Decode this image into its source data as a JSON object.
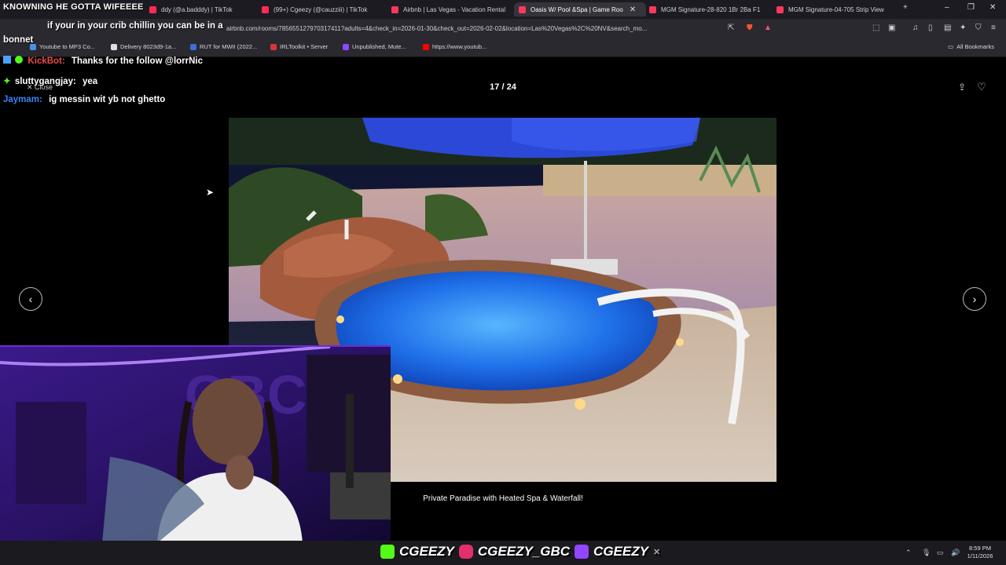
{
  "tabs": [
    {
      "label": "ddy (@a.badddy) | TikTok",
      "color": "#fe2c55"
    },
    {
      "label": "(99+) Cgeezy (@cauzziii) | TikTok",
      "color": "#fe2c55"
    },
    {
      "label": "Airbnb | Las Vegas - Vacation Rental",
      "color": "#ff385c"
    },
    {
      "label": "Oasis W/ Pool &Spa | Game Roo",
      "color": "#ff385c",
      "active": true
    },
    {
      "label": "MGM Signature-28-820 1Br 2Ba F1",
      "color": "#ff385c"
    },
    {
      "label": "MGM Signature-04-705 Strip View",
      "color": "#ff385c"
    }
  ],
  "address_bar": {
    "url": "airbnb.com/rooms/785655127970317411?adults=4&check_in=2026-01-30&check_out=2026-02-02&location=Las%20Vegas%2C%20NV&search_mo..."
  },
  "bookmarks": [
    {
      "label": "Youtube to MP3 Co...",
      "color": "#4a90e2"
    },
    {
      "label": "Delivery 8023d9-1a...",
      "color": "#e0e0e0"
    },
    {
      "label": "RUT for MWII (2022...",
      "color": "#3b6fd6"
    },
    {
      "label": "IRLToolkit • Server",
      "color": "#d93636"
    },
    {
      "label": "Unpublished, Mute...",
      "color": "#9146ff"
    },
    {
      "label": "https://www.youtub...",
      "color": "#ff0000"
    }
  ],
  "all_bookmarks_label": "All Bookmarks",
  "viewer": {
    "counter": "17 / 24",
    "close_label": "Close",
    "caption": "Private Paradise with Heated Spa & Waterfall!",
    "prev_glyph": "‹",
    "next_glyph": "›"
  },
  "overlay": {
    "title": "KNOWNING HE GOTTA WIFEEEE",
    "chat": [
      {
        "user": "",
        "msg": "if your in your crib chillin you can be in a",
        "color": "#e84a4a"
      },
      {
        "user": "",
        "msg": "bonnet",
        "color": "#ffffff"
      },
      {
        "user": "KickBot:",
        "msg": "Thanks for the follow @lorrNic",
        "color": "#e84a4a"
      },
      {
        "user": "sluttygangjay:",
        "msg": "yea",
        "color": "#ffffff"
      },
      {
        "user": "Jaymam:",
        "msg": "ig messin wit yb not ghetto",
        "color": "#3b82f6"
      }
    ]
  },
  "socials": {
    "handles": [
      "CGEEZY",
      "CGEEZY_GBC",
      "CGEEZY"
    ],
    "icon_colors": [
      "#53fc18",
      "#e1306c",
      "#9146ff"
    ]
  },
  "clock": {
    "time": "8:59 PM",
    "date": "1/11/2026"
  }
}
